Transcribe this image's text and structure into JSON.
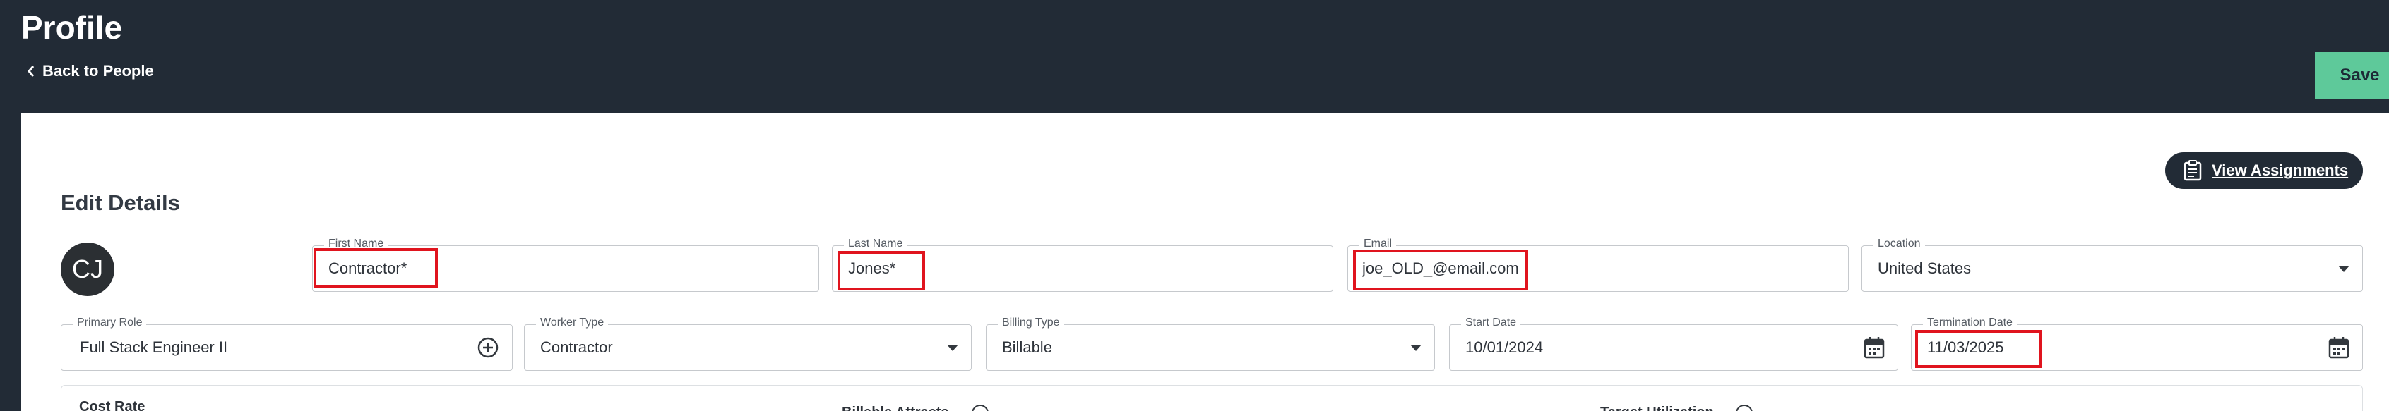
{
  "header": {
    "title": "Profile",
    "back_label": "Back to People",
    "save_label": "Save"
  },
  "colors": {
    "header_bg": "#222b36",
    "save_bg": "#5ec99a",
    "highlight": "#e0141e"
  },
  "actions": {
    "view_assignments_label": "View Assignments"
  },
  "details": {
    "title": "Edit Details",
    "avatar_initials": "CJ",
    "first_name": {
      "label": "First Name",
      "value": "Contractor*"
    },
    "last_name": {
      "label": "Last Name",
      "value": "Jones*"
    },
    "email": {
      "label": "Email",
      "value": "joe_OLD_@email.com"
    },
    "location": {
      "label": "Location",
      "value": "United States"
    },
    "primary_role": {
      "label": "Primary Role",
      "value": "Full Stack Engineer II"
    },
    "worker_type": {
      "label": "Worker Type",
      "value": "Contractor"
    },
    "billing_type": {
      "label": "Billing Type",
      "value": "Billable"
    },
    "start_date": {
      "label": "Start Date",
      "value": "10/01/2024"
    },
    "termination_date": {
      "label": "Termination Date",
      "value": "11/03/2025"
    }
  },
  "bottom": {
    "cost_rate_label": "Cost Rate",
    "bill_label_partial": "Billable Attracts",
    "util_label_partial": "Target Utilization"
  },
  "icons": [
    "chevron-left-icon",
    "clipboard-icon",
    "add-circle-icon",
    "caret-down-icon",
    "calendar-icon",
    "info-icon"
  ]
}
